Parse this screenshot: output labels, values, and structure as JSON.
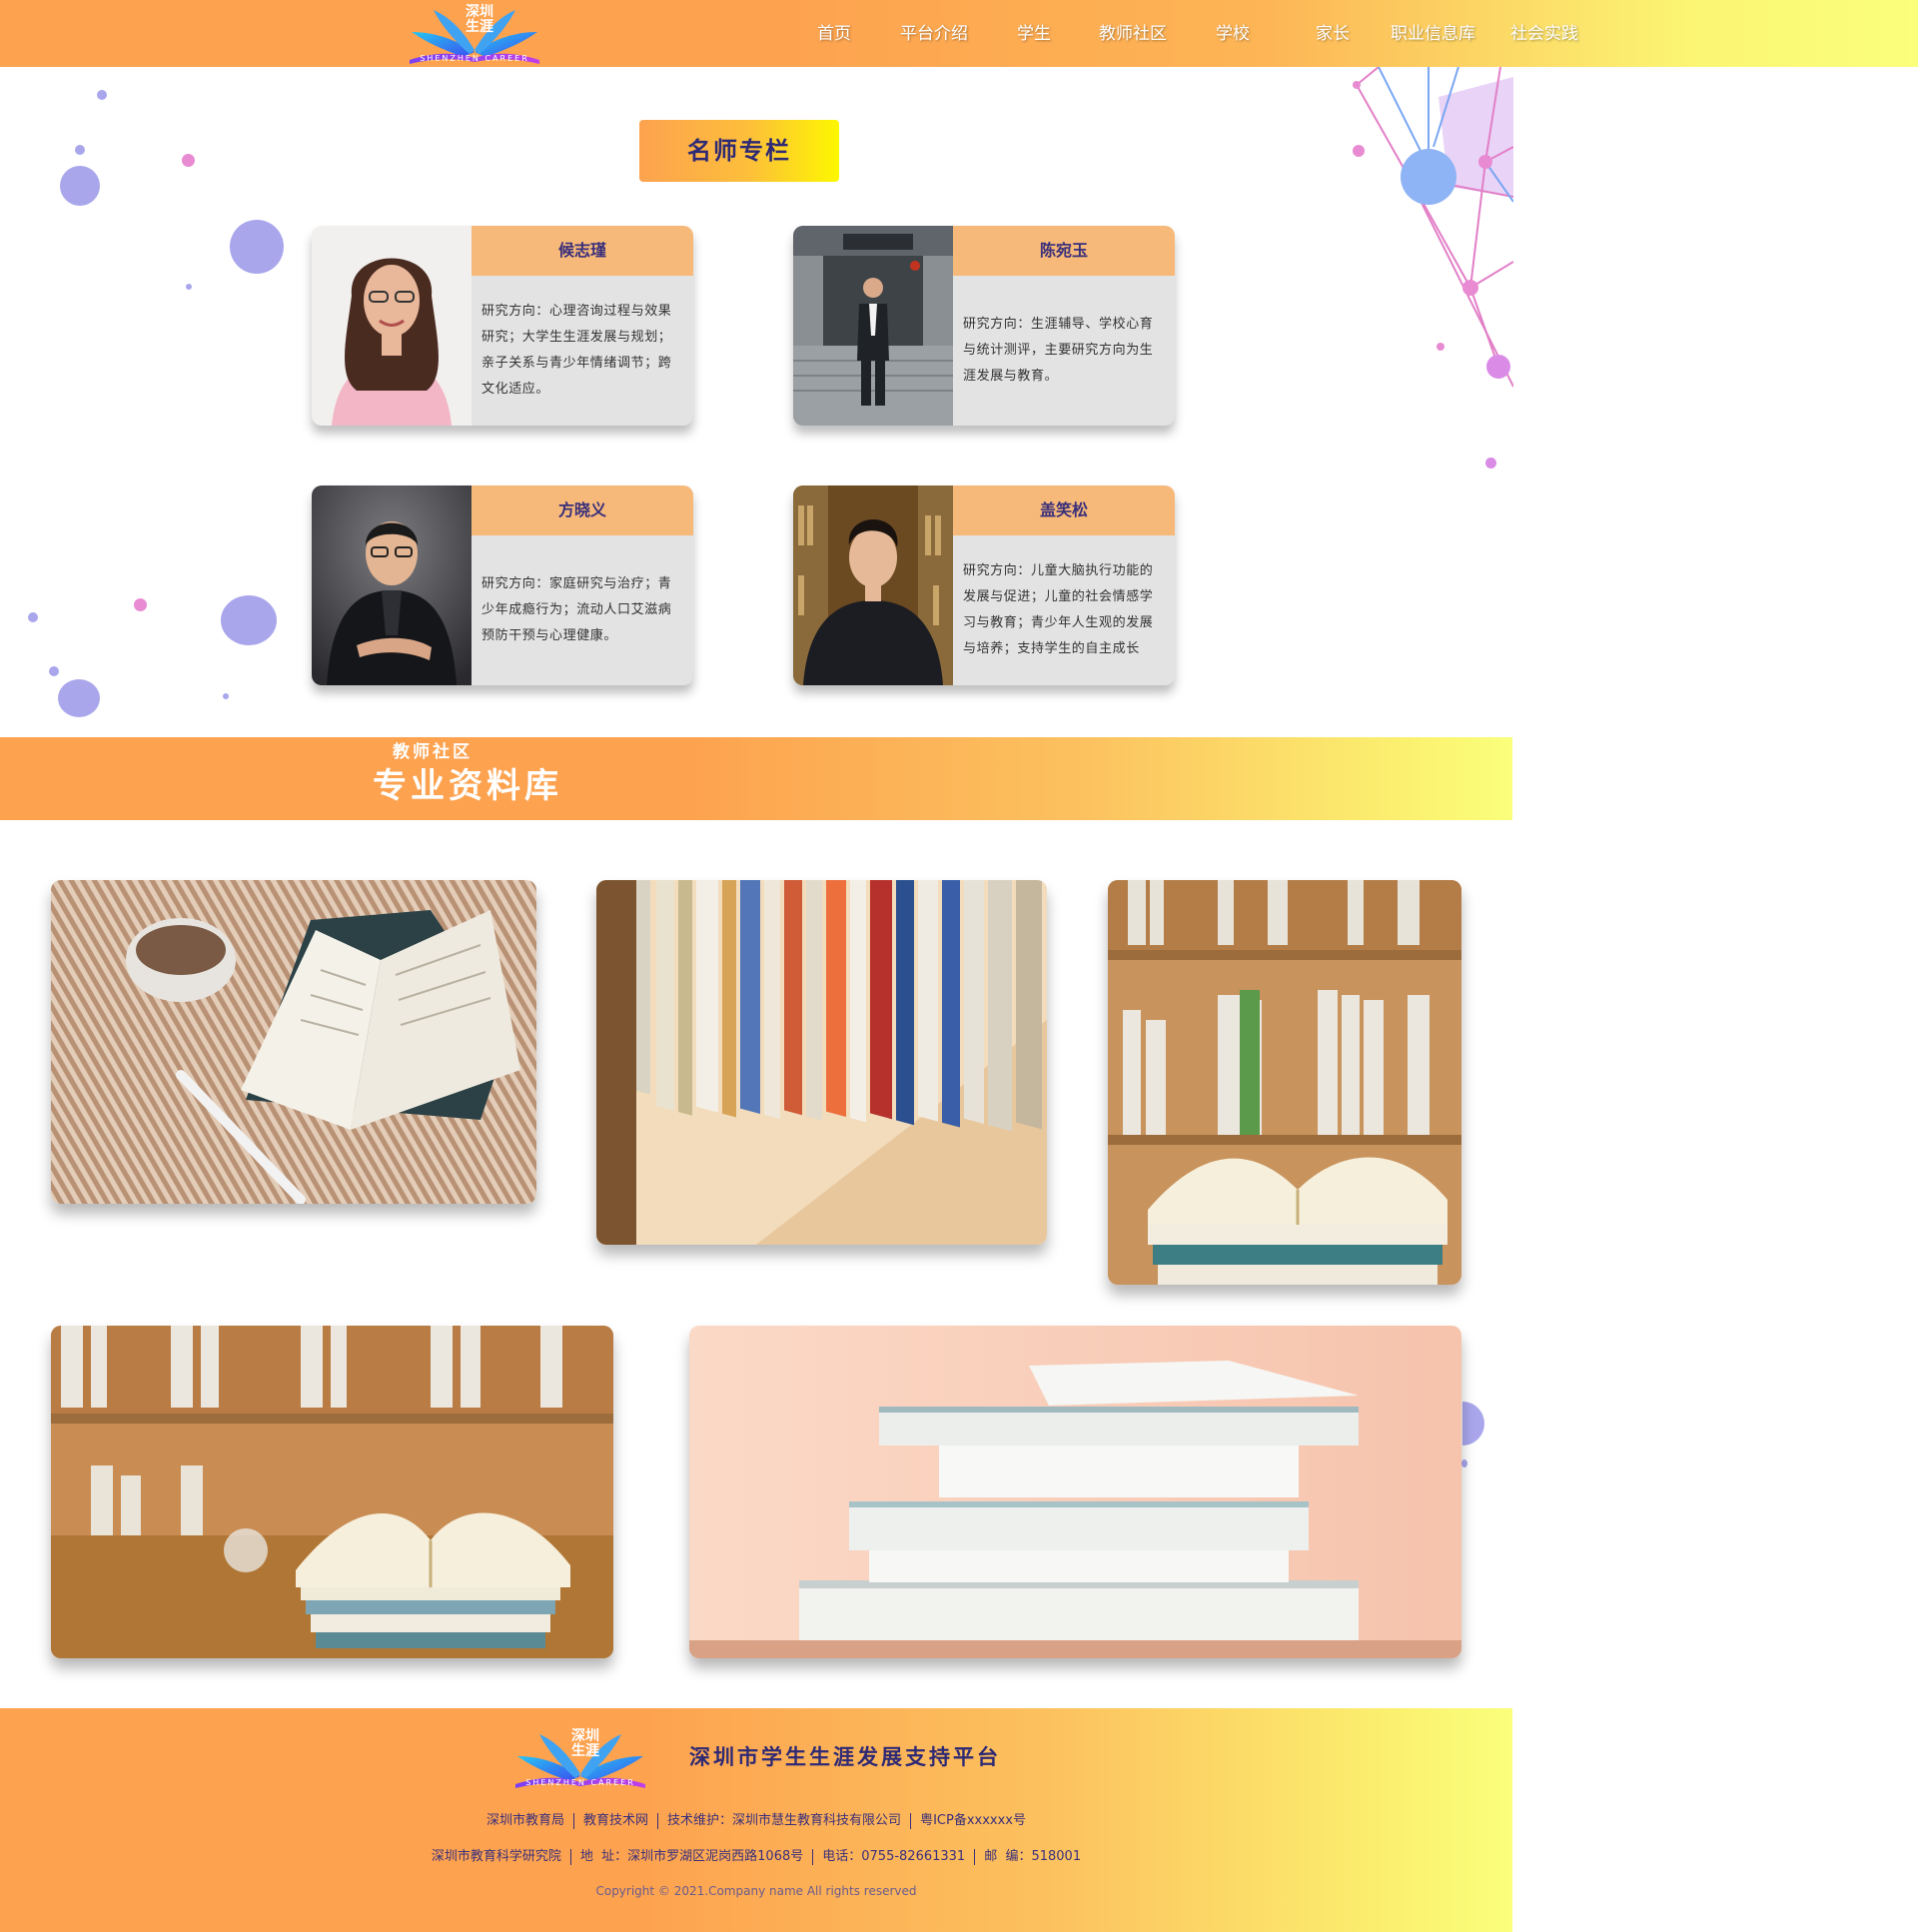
{
  "colors": {
    "brand_orange": "#fda24f",
    "brand_yellow": "#faff7c",
    "title_navy": "#2f2a74",
    "card_header": "#f6b97a",
    "card_body": "#e3e3e3"
  },
  "header": {
    "logo": {
      "title": "深圳\n生涯",
      "subtitle": "SHENZHEN CAREER",
      "icon": "open-book-wings-logo"
    },
    "nav": [
      {
        "label": "首页"
      },
      {
        "label": "平台介绍"
      },
      {
        "label": "学生"
      },
      {
        "label": "教师社区"
      },
      {
        "label": "学校"
      },
      {
        "label": "家长"
      },
      {
        "label": "职业信息库"
      },
      {
        "label": "社会实践"
      }
    ]
  },
  "teachers": {
    "section_title": "名师专栏",
    "cards": [
      {
        "name": "候志瑾",
        "desc": "研究方向：心理咨询过程与效果研究；大学生生涯发展与规划；亲子关系与青少年情绪调节；跨文化适应。",
        "photo": "portrait-woman"
      },
      {
        "name": "陈宛玉",
        "desc": "研究方向：生涯辅导、学校心育与统计测评，主要研究方向为生涯发展与教育。",
        "photo": "portrait-man-standing"
      },
      {
        "name": "方晓义",
        "desc": "研究方向：家庭研究与治疗；青少年成瘾行为；流动人口艾滋病预防干预与心理健康。",
        "photo": "portrait-man-seated"
      },
      {
        "name": "盖笑松",
        "desc": "研究方向：儿童大脑执行功能的发展与促进；儿童的社会情感学习与教育；青少年人生观的发展与培养；支持学生的自主成长",
        "photo": "portrait-young-man"
      }
    ]
  },
  "library": {
    "banner_small": "教师社区",
    "banner_big": "专业资料库",
    "photos": [
      {
        "name": "open-book-with-coffee"
      },
      {
        "name": "bookshelf-closeup"
      },
      {
        "name": "books-on-shelf-open-book"
      },
      {
        "name": "open-book-stack-on-desk"
      },
      {
        "name": "stacked-books-peach"
      }
    ]
  },
  "footer": {
    "logo": {
      "title": "深圳\n生涯",
      "subtitle": "SHENZHEN CAREER"
    },
    "title": "深圳市学生生涯发展支持平台",
    "row1": [
      "深圳市教育局",
      "教育技术网",
      "技术维护：深圳市慧生教育科技有限公司",
      "粤ICP备xxxxxx号"
    ],
    "row2": [
      "深圳市教育科学研究院",
      "地  址：深圳市罗湖区泥岗西路1068号",
      "电话：0755-82661331",
      "邮  编：518001"
    ],
    "copyright": "Copyright © 2021.Company name All rights reserved"
  }
}
